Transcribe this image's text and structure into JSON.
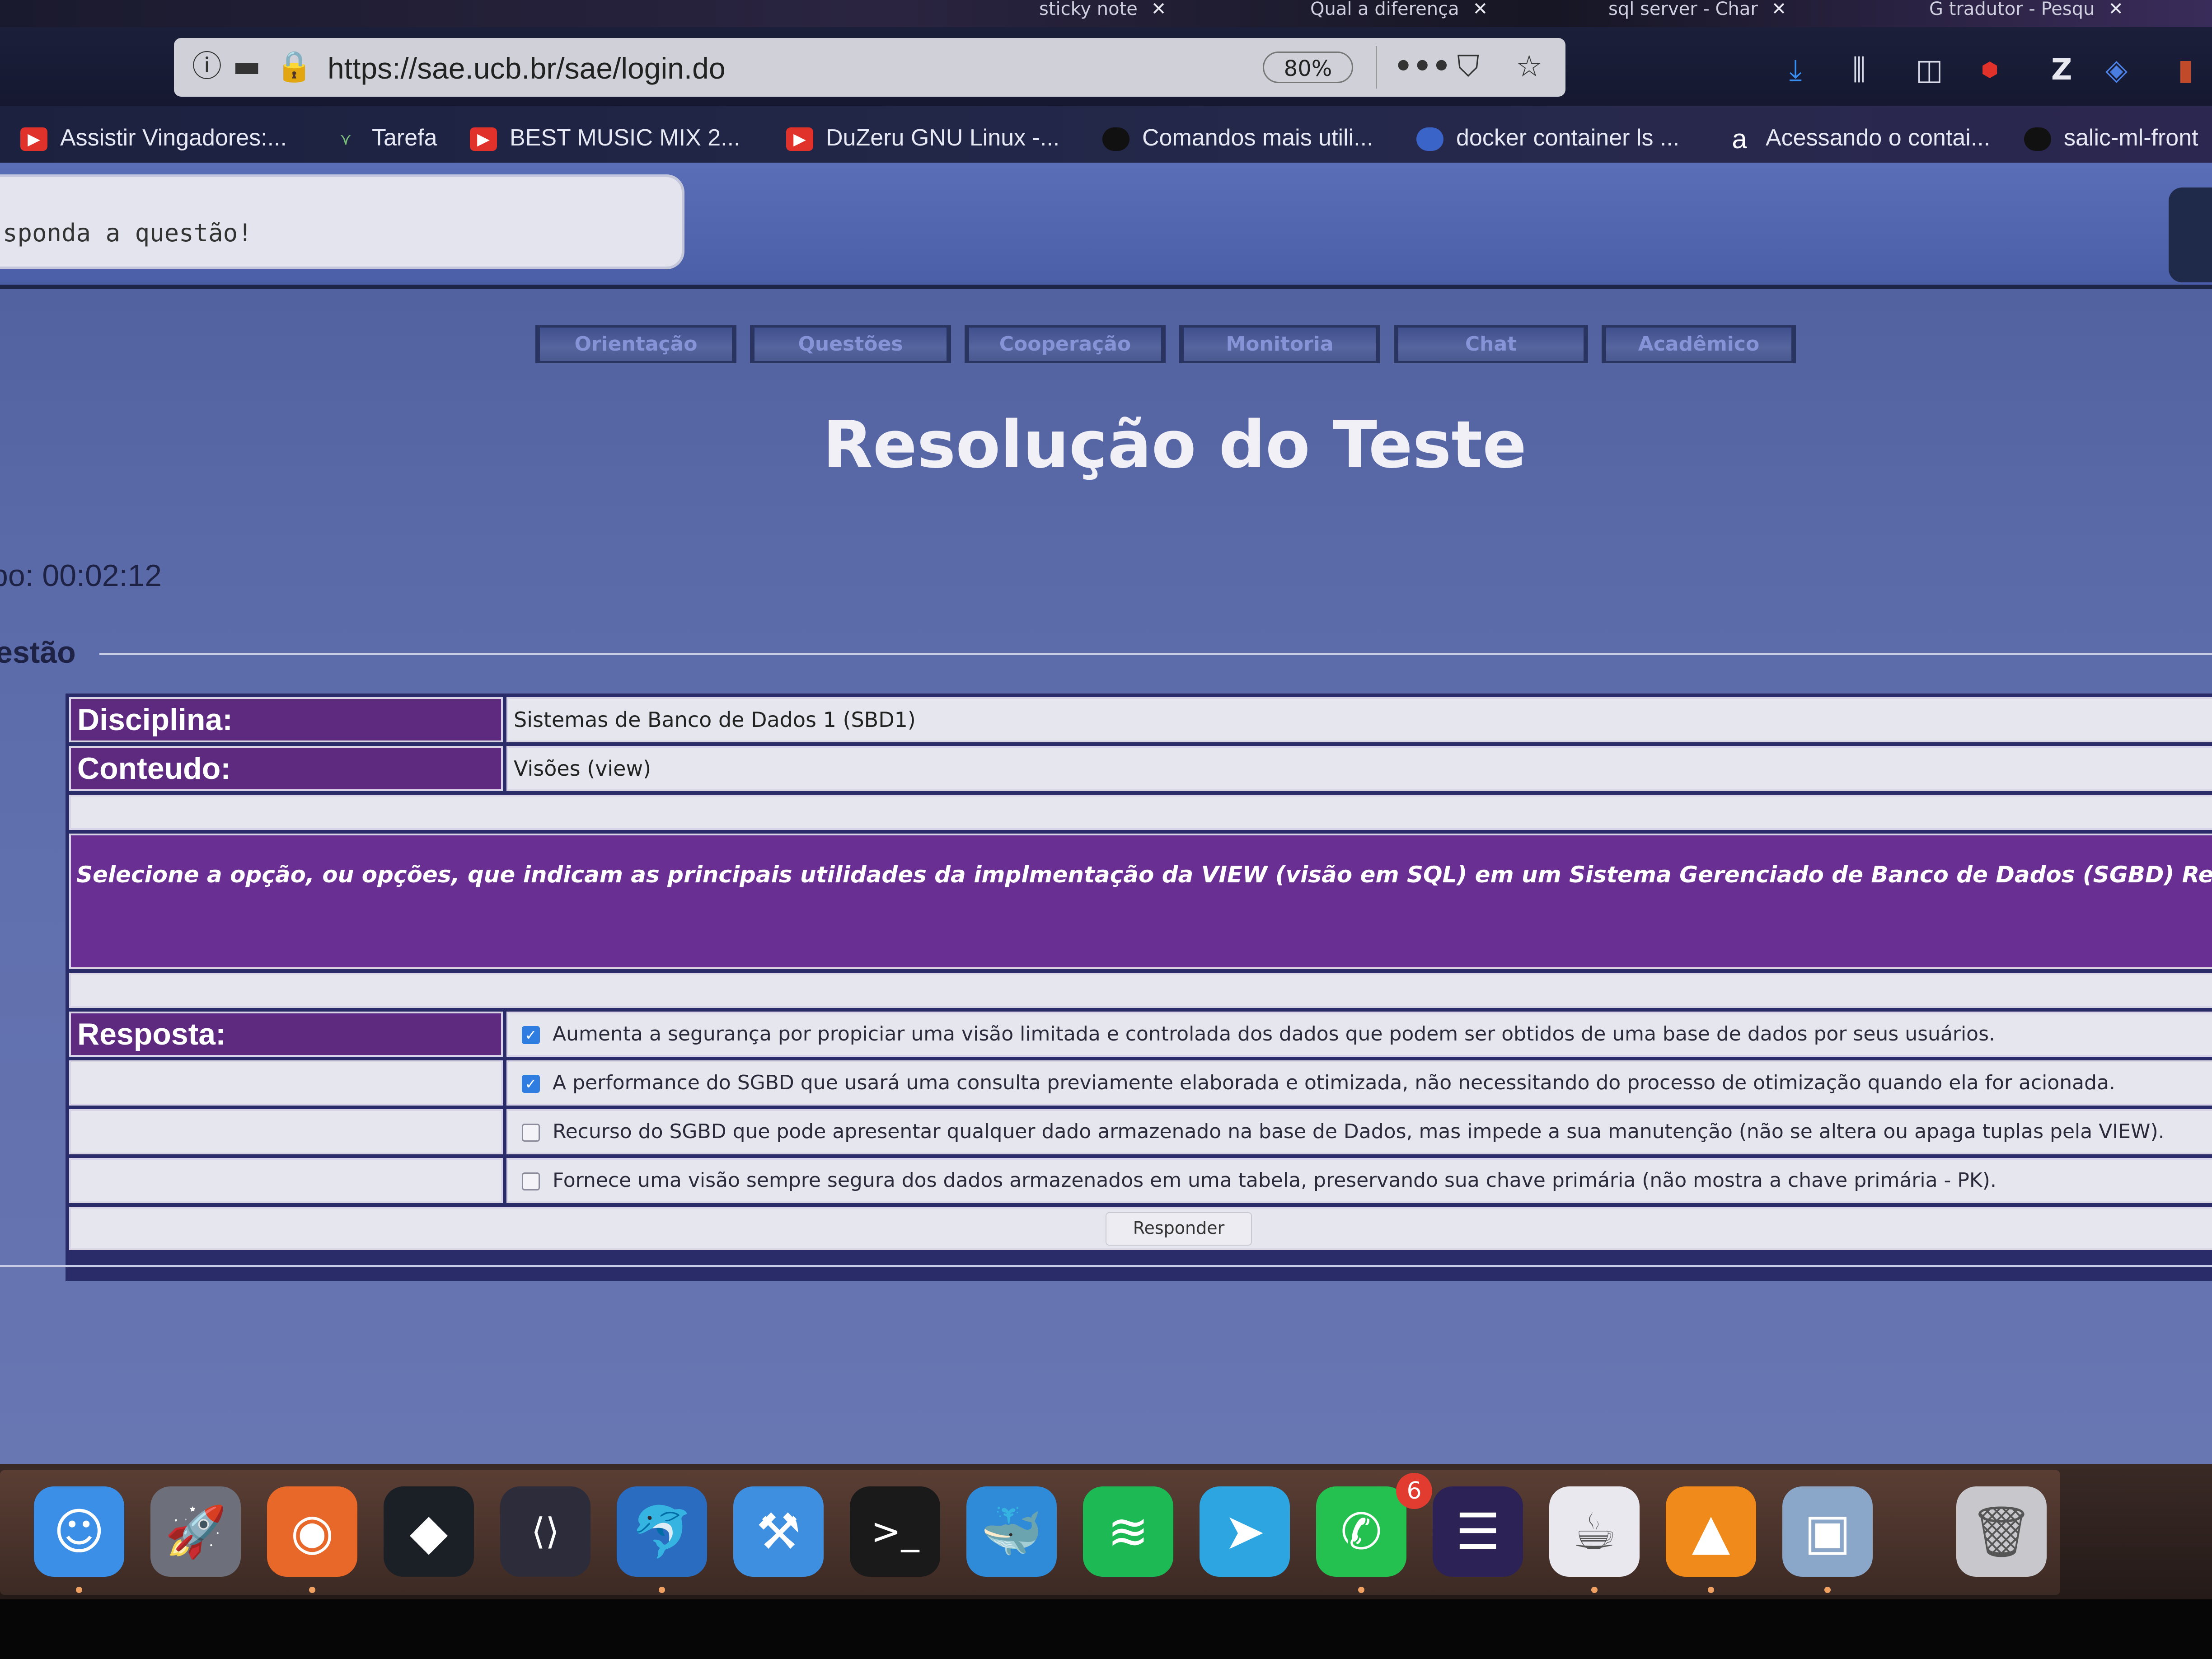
{
  "browser": {
    "tabs": [
      {
        "label": "sticky note"
      },
      {
        "label": "Qual a diferença"
      },
      {
        "label": "sql server - Char"
      },
      {
        "label": "tradutor - Pesqu"
      }
    ],
    "url": "https://sae.ucb.br/sae/login.do",
    "zoom": "80%",
    "menu_label": "•••"
  },
  "bookmarks": [
    {
      "label": "Assistir Vingadores:...",
      "color": "#e0322a"
    },
    {
      "label": "Tarefa",
      "color": "#3a6a3a"
    },
    {
      "label": "BEST MUSIC MIX 2...",
      "color": "#e0322a"
    },
    {
      "label": "DuZeru GNU Linux -...",
      "color": "#e0322a"
    },
    {
      "label": "Comandos mais utili...",
      "color": "#111111"
    },
    {
      "label": "docker container ls ...",
      "color": "#3a64c8"
    },
    {
      "label": "Acessando o contai...",
      "color": "#222233"
    },
    {
      "label": "salic-ml-front",
      "color": "#111111"
    }
  ],
  "page": {
    "header_message": "sponda a questão!",
    "nav": [
      "Orientação",
      "Questões",
      "Cooperação",
      "Monitoria",
      "Chat",
      "Acadêmico"
    ],
    "title": "Resolução do Teste",
    "timer": "po: 00:02:12",
    "fieldset_legend": "estão",
    "disciplina_label": "Disciplina:",
    "disciplina_value": "Sistemas de Banco de Dados 1 (SBD1)",
    "conteudo_label": "Conteudo:",
    "conteudo_value": "Visões (view)",
    "question": "Selecione a opção, ou opções, que indicam as principais utilidades da implmentação da VIEW (visão em SQL) em um Sistema Gerenciado de Banco de Dados (SGBD) Relaciona",
    "resposta_label": "Resposta:",
    "options": [
      {
        "text": "Aumenta a segurança por propiciar uma visão limitada e controlada dos dados que podem ser obtidos de uma base de dados por seus usuários.",
        "checked": true
      },
      {
        "text": "A performance do SGBD que usará uma consulta previamente elaborada e otimizada, não necessitando do processo de otimização quando ela for acionada.",
        "checked": true
      },
      {
        "text": "Recurso do SGBD que pode apresentar qualquer dado armazenado na base de Dados, mas impede a sua manutenção (não se altera ou apaga tuplas pela VIEW).",
        "checked": false
      },
      {
        "text": "Fornece uma visão sempre segura dos dados armazenados em uma tabela, preservando sua chave primária (não mostra a chave primária - PK).",
        "checked": false
      }
    ],
    "submit_label": "Responder"
  },
  "dock": {
    "apps": [
      {
        "name": "finder",
        "color": "#3b8fe6"
      },
      {
        "name": "launchpad",
        "color": "#6d6f7a"
      },
      {
        "name": "firefox",
        "color": "#e8682a"
      },
      {
        "name": "filmora",
        "color": "#1b1f26"
      },
      {
        "name": "vscode",
        "color": "#2c2c3a"
      },
      {
        "name": "mysql-workbench",
        "color": "#2a6cc0"
      },
      {
        "name": "xcode",
        "color": "#3f8fe0"
      },
      {
        "name": "terminal",
        "color": "#1a1a1a"
      },
      {
        "name": "docker",
        "color": "#2f8ad8"
      },
      {
        "name": "spotify",
        "color": "#1db954"
      },
      {
        "name": "telegram",
        "color": "#2ca5e0"
      },
      {
        "name": "whatsapp",
        "color": "#25c150"
      },
      {
        "name": "eclipse",
        "color": "#2c2255"
      },
      {
        "name": "java",
        "color": "#e8e8ee"
      },
      {
        "name": "vlc",
        "color": "#f08a1a"
      },
      {
        "name": "preview",
        "color": "#8aa6c8"
      },
      {
        "name": "trash",
        "color": "#c8c8cc"
      }
    ],
    "whatsapp_badge": "6"
  }
}
